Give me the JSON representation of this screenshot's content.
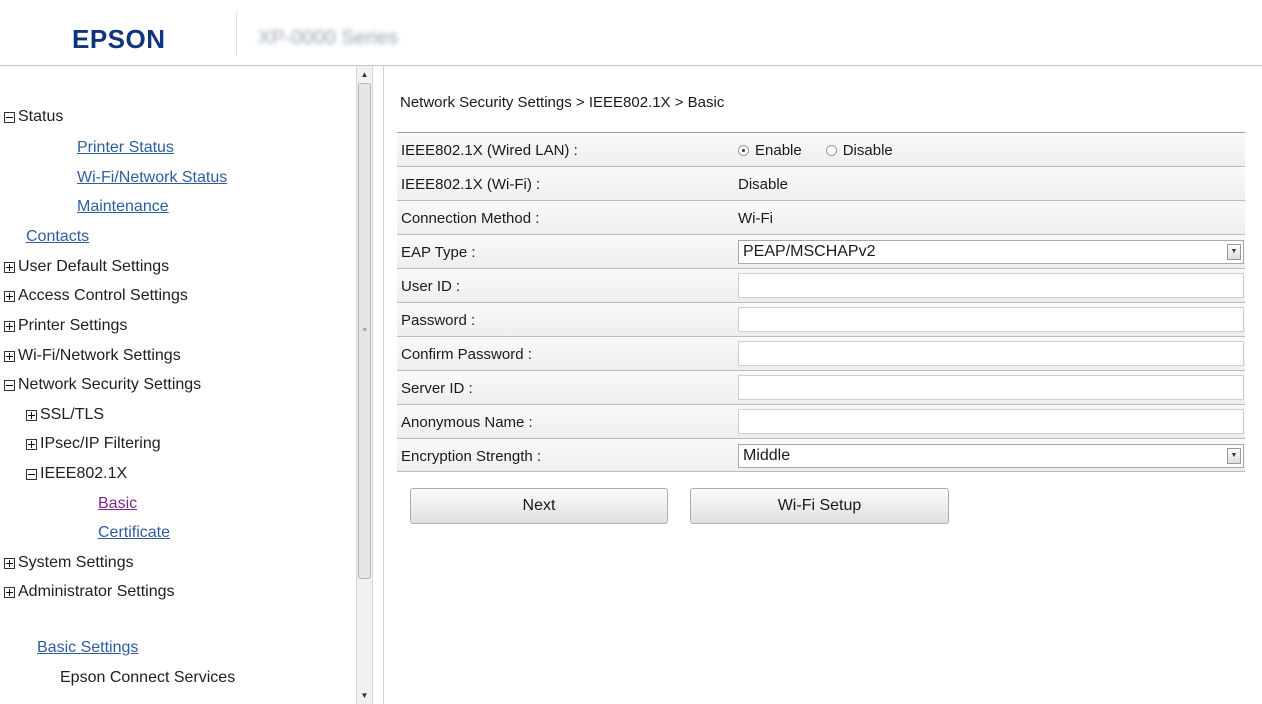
{
  "header": {
    "brand": "EPSON",
    "model": "XP-0000 Series"
  },
  "sidebar": {
    "status": "Status",
    "printer_status": "Printer Status",
    "wifi_network_status": "Wi-Fi/Network Status",
    "maintenance": "Maintenance",
    "contacts": "Contacts",
    "user_default_settings": "User Default Settings",
    "access_control_settings": "Access Control Settings",
    "printer_settings": "Printer Settings",
    "wifi_network_settings": "Wi-Fi/Network Settings",
    "network_security_settings": "Network Security Settings",
    "ssl_tls": "SSL/TLS",
    "ipsec_ip_filtering": "IPsec/IP Filtering",
    "ieee8021x": "IEEE802.1X",
    "basic": "Basic",
    "certificate": "Certificate",
    "system_settings": "System Settings",
    "administrator_settings": "Administrator Settings",
    "basic_settings": "Basic Settings",
    "epson_connect_services": "Epson Connect Services"
  },
  "main": {
    "breadcrumb": "Network Security Settings > IEEE802.1X > Basic",
    "wired_lan": {
      "label": "IEEE802.1X (Wired LAN) :",
      "options": [
        "Enable",
        "Disable"
      ],
      "selected": "Enable"
    },
    "wifi": {
      "label": "IEEE802.1X (Wi-Fi) :",
      "value": "Disable"
    },
    "connection_method": {
      "label": "Connection Method :",
      "value": "Wi-Fi"
    },
    "eap_type": {
      "label": "EAP Type :",
      "value": "PEAP/MSCHAPv2"
    },
    "user_id": {
      "label": "User ID :",
      "value": ""
    },
    "password": {
      "label": "Password :",
      "value": ""
    },
    "confirm_password": {
      "label": "Confirm Password :",
      "value": ""
    },
    "server_id": {
      "label": "Server ID :",
      "value": ""
    },
    "anonymous_name": {
      "label": "Anonymous Name :",
      "value": ""
    },
    "encryption_strength": {
      "label": "Encryption Strength :",
      "value": "Middle"
    },
    "buttons": {
      "next": "Next",
      "wifi_setup": "Wi-Fi Setup"
    }
  },
  "icons": {
    "expand": "plus-box-icon",
    "collapse": "minus-box-icon",
    "dropdown": "chevron-down-icon"
  },
  "colors": {
    "brand": "#10357f",
    "link": "#2e5d9e",
    "visited_link": "#7a2a8a"
  }
}
